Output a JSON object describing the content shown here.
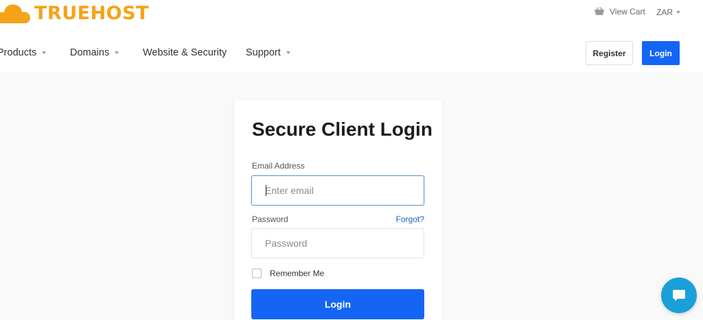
{
  "brand": {
    "name": "TRUEHOST",
    "color": "#f5a316"
  },
  "topbar": {
    "cart_label": "View Cart",
    "currency": "ZAR"
  },
  "nav": {
    "items": [
      {
        "label": "Products",
        "has_dropdown": true
      },
      {
        "label": "Domains",
        "has_dropdown": true
      },
      {
        "label": "Website & Security",
        "has_dropdown": false
      },
      {
        "label": "Support",
        "has_dropdown": true
      }
    ],
    "register_label": "Register",
    "login_label": "Login"
  },
  "login_form": {
    "title": "Secure Client Login",
    "email_label": "Email Address",
    "email_placeholder": "Enter email",
    "email_value": "",
    "password_label": "Password",
    "forgot_label": "Forgot?",
    "password_placeholder": "Password",
    "password_value": "",
    "remember_label": "Remember Me",
    "remember_checked": false,
    "submit_label": "Login"
  },
  "colors": {
    "accent": "#1565f5",
    "chat": "#1aa0d8"
  },
  "icons": {
    "cart": "basket-icon",
    "chat": "chat-bubble-icon",
    "logo": "cloud-icon"
  }
}
